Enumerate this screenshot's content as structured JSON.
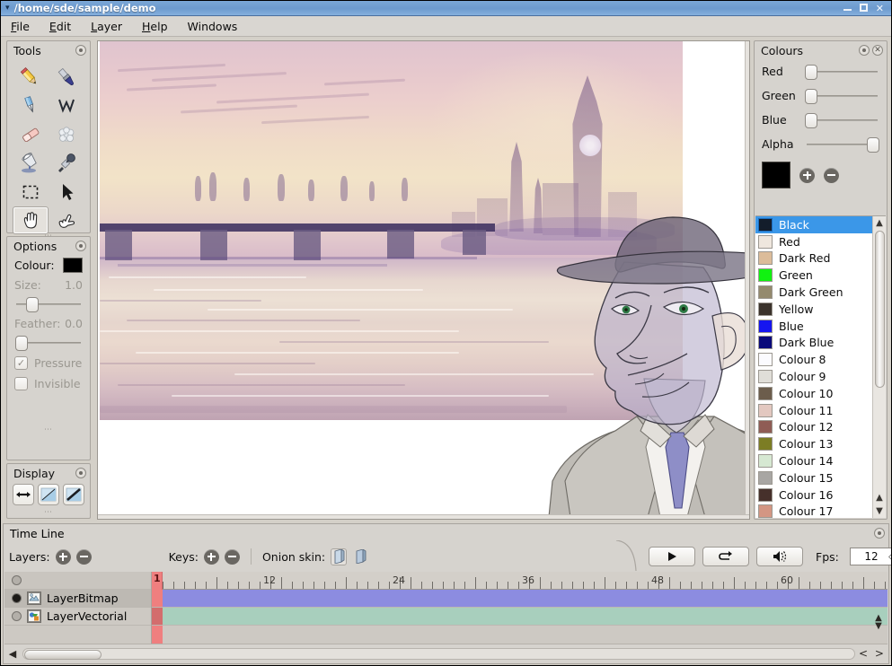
{
  "window": {
    "title": "/home/sde/sample/demo",
    "menu_glyph": "▾",
    "minimize": "minimize-icon",
    "maximize": "maximize-icon",
    "close": "✕"
  },
  "menubar": [
    {
      "label": "File",
      "accel": "F"
    },
    {
      "label": "Edit",
      "accel": "E"
    },
    {
      "label": "Layer",
      "accel": "L"
    },
    {
      "label": "Help",
      "accel": "H"
    },
    {
      "label": "Windows",
      "accel": ""
    }
  ],
  "tools_panel": {
    "title": "Tools",
    "items": [
      {
        "name": "pencil-tool",
        "label": "Pencil",
        "selected": false
      },
      {
        "name": "brush-tool",
        "label": "Brush",
        "selected": false
      },
      {
        "name": "pen-tool",
        "label": "Pen",
        "selected": false
      },
      {
        "name": "polyline-tool",
        "label": "Polyline",
        "selected": false
      },
      {
        "name": "eraser-tool",
        "label": "Eraser",
        "selected": false
      },
      {
        "name": "smudge-tool",
        "label": "Smudge",
        "selected": false
      },
      {
        "name": "bucket-tool",
        "label": "Bucket",
        "selected": false
      },
      {
        "name": "eyedropper-tool",
        "label": "Eyedropper",
        "selected": false
      },
      {
        "name": "select-tool",
        "label": "Select",
        "selected": false
      },
      {
        "name": "move-tool",
        "label": "Move",
        "selected": false
      },
      {
        "name": "hand-tool",
        "label": "Hand",
        "selected": true
      },
      {
        "name": "edit-tool",
        "label": "Edit",
        "selected": false
      }
    ]
  },
  "options_panel": {
    "title": "Options",
    "colour_label": "Colour:",
    "colour_value": "#000000",
    "size_label": "Size:",
    "size_value": "1.0",
    "size_pct": 17,
    "feather_label": "Feather:",
    "feather_value": "0.0",
    "feather_pct": 2,
    "pressure_label": "Pressure",
    "pressure_checked": true,
    "invisible_label": "Invisible",
    "invisible_checked": false
  },
  "display_panel": {
    "title": "Display",
    "buttons": [
      {
        "name": "mirror-horizontal-button",
        "label": "Horizontal flip"
      },
      {
        "name": "thin-lines-button",
        "label": "Thin lines"
      },
      {
        "name": "outlines-button",
        "label": "Outlines"
      }
    ]
  },
  "colours_panel": {
    "title": "Colours",
    "sliders": [
      {
        "label": "Red",
        "name": "red-slider",
        "pct": 0
      },
      {
        "label": "Green",
        "name": "green-slider",
        "pct": 0
      },
      {
        "label": "Blue",
        "name": "blue-slider",
        "pct": 0
      },
      {
        "label": "Alpha",
        "name": "alpha-slider",
        "pct": 100
      }
    ],
    "current_colour": "#000000",
    "add_label": "+",
    "remove_label": "−",
    "swatches": [
      {
        "label": "Black",
        "hex": "#131d2b",
        "selected": true
      },
      {
        "label": "Red",
        "hex": "#efe7de",
        "selected": false
      },
      {
        "label": "Dark Red",
        "hex": "#dcbc9a",
        "selected": false
      },
      {
        "label": "Green",
        "hex": "#11f211",
        "selected": false
      },
      {
        "label": "Dark Green",
        "hex": "#948a6e",
        "selected": false
      },
      {
        "label": "Yellow",
        "hex": "#3b332c",
        "selected": false
      },
      {
        "label": "Blue",
        "hex": "#1515f0",
        "selected": false
      },
      {
        "label": "Dark Blue",
        "hex": "#0a0a7a",
        "selected": false
      },
      {
        "label": "Colour 8",
        "hex": "#fbfbff",
        "selected": false
      },
      {
        "label": "Colour 9",
        "hex": "#e0ded8",
        "selected": false
      },
      {
        "label": "Colour 10",
        "hex": "#6c5d4c",
        "selected": false
      },
      {
        "label": "Colour 11",
        "hex": "#e3c8c0",
        "selected": false
      },
      {
        "label": "Colour 12",
        "hex": "#8f5c55",
        "selected": false
      },
      {
        "label": "Colour 13",
        "hex": "#7c7d24",
        "selected": false
      },
      {
        "label": "Colour 14",
        "hex": "#d6e8d2",
        "selected": false
      },
      {
        "label": "Colour 15",
        "hex": "#a8a6a3",
        "selected": false
      },
      {
        "label": "Colour 16",
        "hex": "#46302b",
        "selected": false
      },
      {
        "label": "Colour 17",
        "hex": "#d39683",
        "selected": false
      }
    ]
  },
  "timeline": {
    "title": "Time Line",
    "layers_label": "Layers:",
    "layers_add": "add-layer-button",
    "layers_remove": "remove-layer-button",
    "keys_label": "Keys:",
    "keys_add": "add-key-button",
    "keys_remove": "remove-key-button",
    "onion_label": "Onion skin:",
    "onion_prev_on": true,
    "onion_next_on": false,
    "play_label": "▶",
    "loop_label": "↺",
    "sound_label": "sound-icon",
    "fps_label": "Fps:",
    "fps_value": "12",
    "current_frame": "1",
    "ruler_marks": [
      "1",
      "12",
      "24",
      "36",
      "48",
      "60"
    ],
    "layers": [
      {
        "name": "LayerBitmap",
        "visible": true,
        "type": "bitmap",
        "colour": "#8c8ce0",
        "selected": true
      },
      {
        "name": "LayerVectorial",
        "visible": false,
        "type": "vectorial",
        "colour": "#a8cfbd",
        "selected": false
      }
    ]
  }
}
